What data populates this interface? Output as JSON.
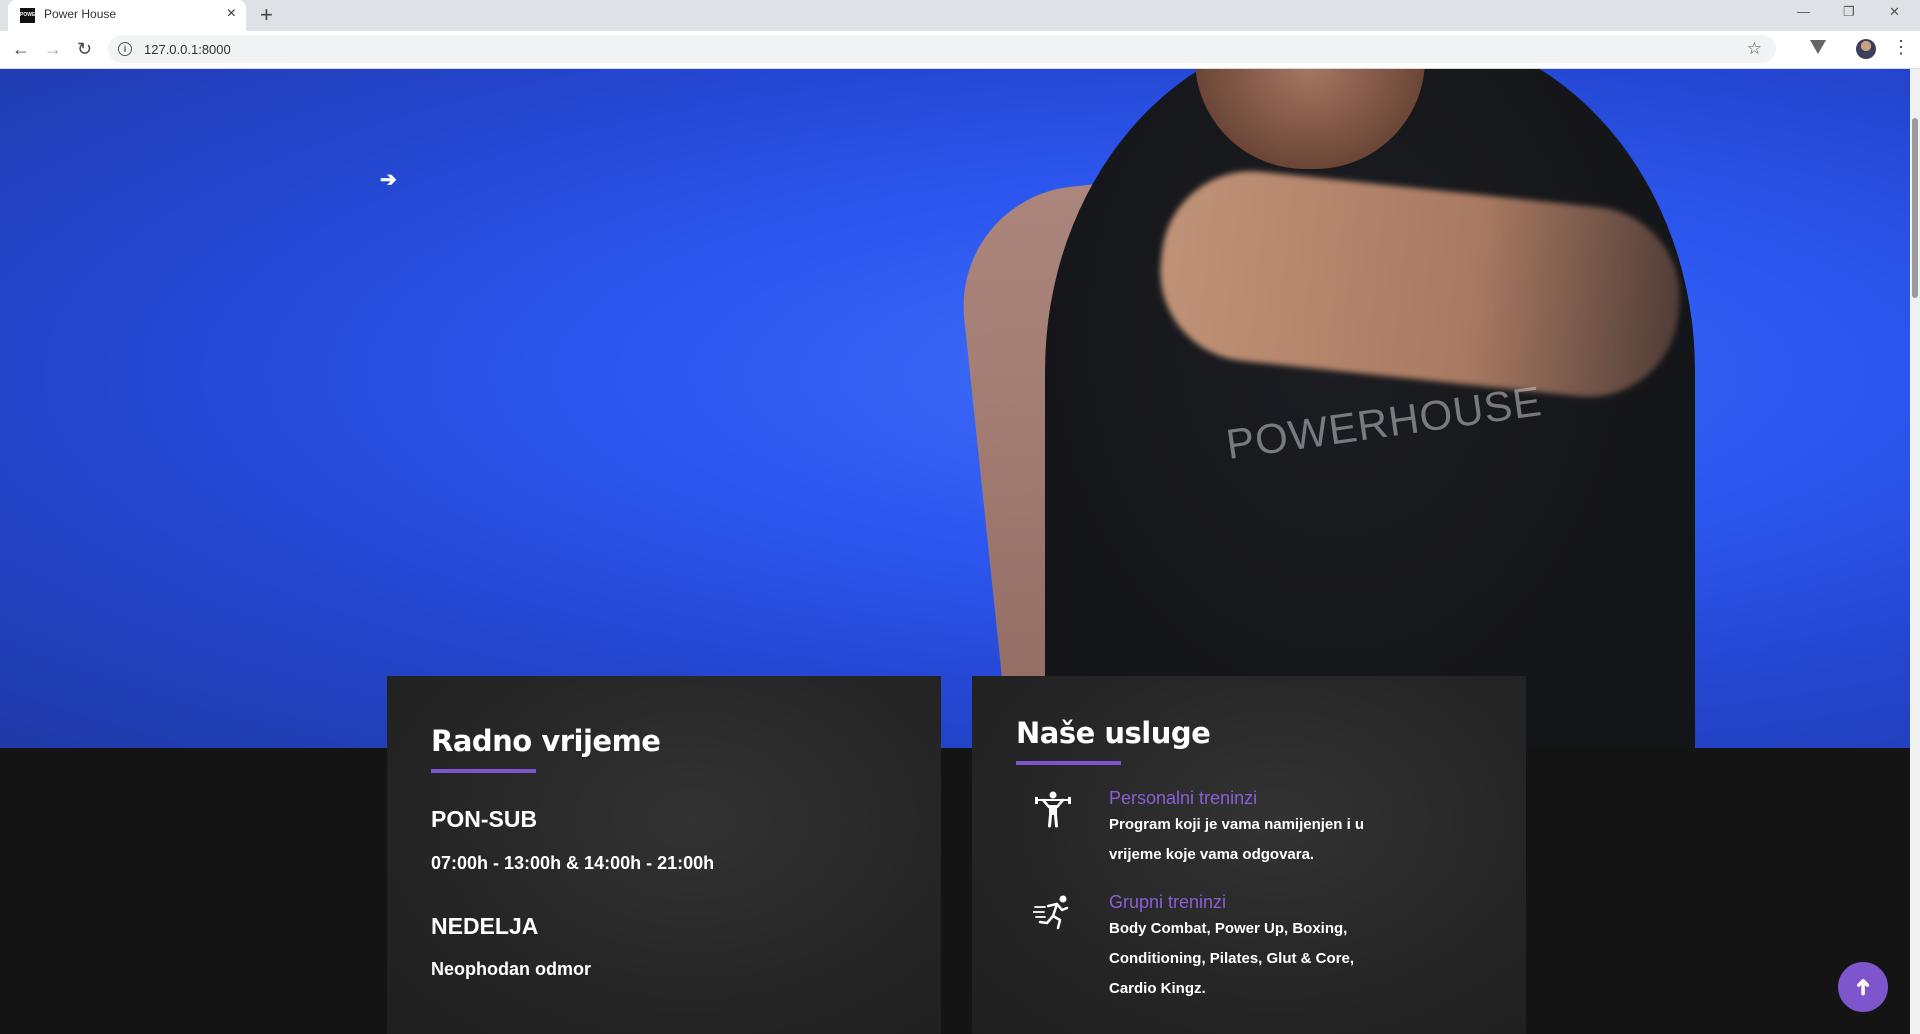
{
  "browser": {
    "tab_title": "Power House",
    "favicon_text": "POWER",
    "url": "127.0.0.1:8000",
    "new_tab": "+",
    "tab_close": "×",
    "back": "←",
    "forward": "→",
    "reload": "↻",
    "star": "☆",
    "menu": "⋮",
    "minimize": "—",
    "restore": "❐",
    "close": "✕"
  },
  "hero": {
    "arrow": "➔",
    "shirt_logo": "POWERHOUSE"
  },
  "hours": {
    "title": "Radno vrijeme",
    "days": [
      {
        "name": "PON-SUB",
        "time": "07:00h - 13:00h & 14:00h - 21:00h"
      },
      {
        "name": "NEDELJA",
        "time": "Neophodan odmor"
      }
    ]
  },
  "services": {
    "title": "Naše usluge",
    "items": [
      {
        "icon": "weightlifter-icon",
        "title": "Personalni treninzi",
        "desc": "Program koji je vama namijenjen i u vrijeme koje vama odgovara."
      },
      {
        "icon": "runner-icon",
        "title": "Grupni treninzi",
        "desc": "Body Combat, Power Up, Boxing, Conditioning, Pilates, Glut & Core, Cardio Kingz."
      }
    ]
  },
  "scroll_top": "➜",
  "colors": {
    "accent": "#7f55ce",
    "hero_blue": "#2c57f0",
    "card_bg": "#262626",
    "page_bg": "#141414"
  }
}
